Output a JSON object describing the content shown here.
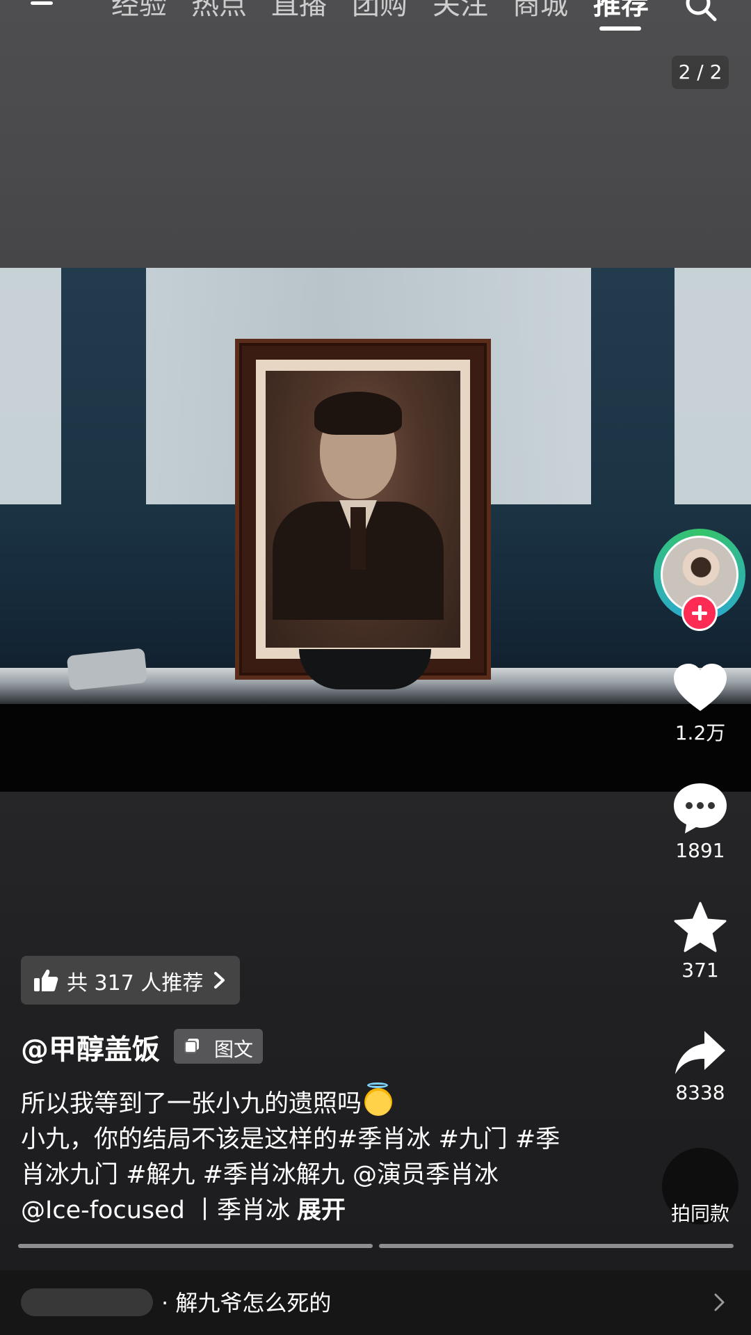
{
  "top_nav": {
    "tabs": [
      "经验",
      "热点",
      "直播",
      "团购",
      "关注",
      "商城",
      "推荐"
    ],
    "active_tab": "推荐"
  },
  "page_counter": "2 / 2",
  "actions": {
    "like_count": "1.2万",
    "comment_count": "1891",
    "favorite_count": "371",
    "share_count": "8338",
    "same_style_label": "拍同款"
  },
  "recommend": {
    "label": "共 317 人推荐"
  },
  "post": {
    "author": "@甲醇盖饭",
    "type_tag": "图文",
    "caption_lines": [
      "所以我等到了一张小九的遗照吗",
      "小九，你的结局不该是这样的#季肖冰 #九门 #季",
      "肖冰九门 #解九 #季肖冰解九 @演员季肖冰",
      "@Ice-focused 丨季肖冰"
    ],
    "expand_label": "展开"
  },
  "related_search": {
    "query": "· 解九爷怎么死的"
  },
  "colors": {
    "follow_red": "#fe2c55",
    "ring_green": "#35c46a",
    "ring_blue": "#2aa7d6"
  },
  "icons": [
    "menu-icon",
    "search-icon",
    "heart-icon",
    "comment-icon",
    "star-icon",
    "share-icon",
    "thumbs-up-icon",
    "chevron-right-icon",
    "image-text-icon"
  ]
}
